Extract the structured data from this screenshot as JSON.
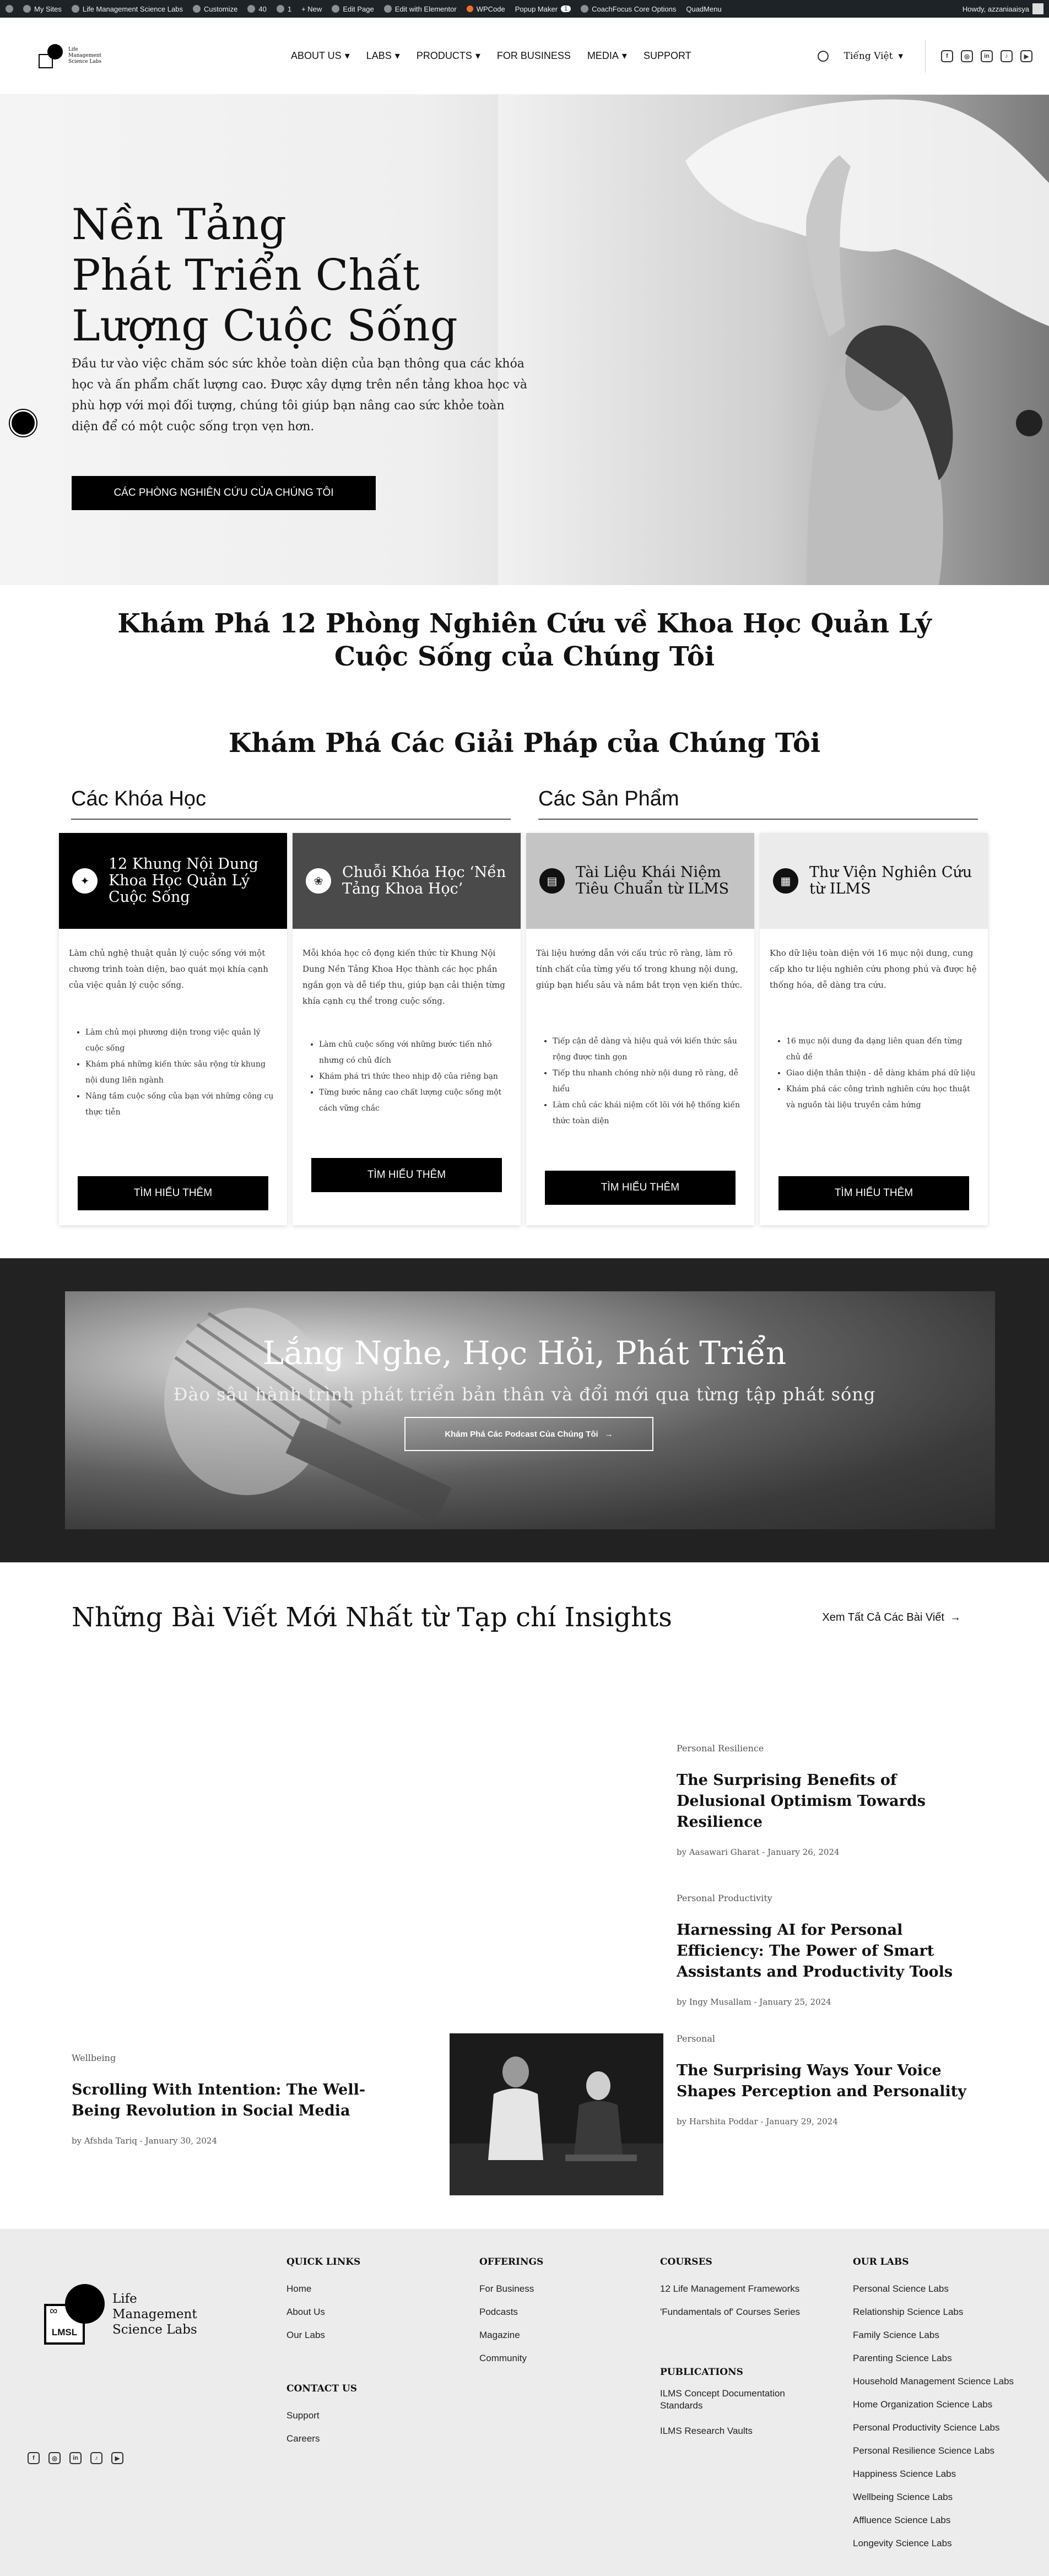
{
  "adminbar": {
    "items": [
      "My Sites",
      "Life Management Science Labs",
      "Customize",
      "40",
      "1",
      "+ New",
      "Edit Page",
      "Edit with Elementor",
      "WPCode",
      "Popup Maker",
      "CoachFocus Core Options",
      "QuadMenu"
    ],
    "popup_badge": "1",
    "howdy": "Howdy, azzaniaaisya"
  },
  "header": {
    "logo_text": "Life Management Science Labs",
    "nav": [
      "ABOUT US",
      "LABS",
      "PRODUCTS",
      "FOR BUSINESS",
      "MEDIA",
      "SUPPORT"
    ],
    "language": "Tiếng Việt"
  },
  "hero": {
    "title_lines": [
      "Nền Tảng",
      "Phát Triển Chất",
      "Lượng Cuộc Sống"
    ],
    "text": "Đầu tư vào việc chăm sóc sức khỏe toàn diện của bạn thông qua các khóa học và ấn phẩm chất lượng cao. Được xây dựng trên nền tảng khoa học và phù hợp với mọi đối tượng, chúng tôi giúp bạn nâng cao sức khỏe toàn diện để có một cuộc sống trọn vẹn hơn.",
    "button": "CÁC PHÒNG NGHIÊN CỨU CỦA CHÚNG TÔI"
  },
  "intro": {
    "title": "Khám Phá 12 Phòng Nghiên Cứu về Khoa Học Quản Lý Cuộc Sống của Chúng Tôi"
  },
  "solutions": {
    "title": "Khám Phá Các Giải Pháp của Chúng Tôi",
    "heading_courses": "Các Khóa Học",
    "heading_products": "Các Sản Phẩm",
    "cards": [
      {
        "title": "12 Khung Nội Dung Khoa Học Quản Lý Cuộc Sống",
        "desc": "Làm chủ nghệ thuật quản lý cuộc sống với một chương trình toàn diện, bao quát mọi khía cạnh của việc quản lý cuộc sống.",
        "items": [
          "Làm chủ mọi phương diện trong việc quản lý cuộc sống",
          "Khám phá những kiến thức sâu rộng từ khung nội dung liên ngành",
          "Nâng tầm cuộc sống của bạn với những công cụ thực tiễn"
        ],
        "button": "TÌM HIỂU THÊM"
      },
      {
        "title": "Chuỗi Khóa Học ‘Nền Tảng Khoa Học’",
        "desc": "Mỗi khóa học cô đọng kiến thức từ Khung Nội Dung Nền Tảng Khoa Học thành các học phần ngắn gọn và dễ tiếp thu, giúp bạn cải thiện từng khía cạnh cụ thể trong cuộc sống.",
        "items": [
          "Làm chủ cuộc sống với những bước tiến nhỏ nhưng có chủ đích",
          "Khám phá tri thức theo nhịp độ của riêng bạn",
          "Từng bước nâng cao chất lượng cuộc sống một cách vững chắc"
        ],
        "button": "TÌM HIỂU THÊM"
      },
      {
        "title": "Tài Liệu Khái Niệm Tiêu Chuẩn từ ILMS",
        "desc": "Tài liệu hướng dẫn với cấu trúc rõ ràng, làm rõ tính chất của từng yếu tố trong khung nội dung, giúp bạn hiểu sâu và nắm bắt trọn vẹn kiến thức.",
        "items": [
          "Tiếp cận dễ dàng và hiệu quả với kiến thức sâu rộng được tinh gọn",
          "Tiếp thu nhanh chóng nhờ nội dung rõ ràng, dễ hiểu",
          "Làm chủ các khái niệm cốt lõi với hệ thống kiến thức toàn diện"
        ],
        "button": "TÌM HIỂU THÊM"
      },
      {
        "title": "Thư Viện Nghiên Cứu từ ILMS",
        "desc": "Kho dữ liệu toàn diện với 16 mục nội dung, cung cấp kho tư liệu nghiên cứu phong phú và được hệ thống hóa, dễ dàng tra cứu.",
        "items": [
          "16 mục nội dung đa dạng liên quan đến từng chủ đề",
          "Giao diện thân thiện - dễ dàng khám phá dữ liệu",
          "Khám phá các công trình nghiên cứu học thuật và nguồn tài liệu truyền cảm hứng"
        ],
        "button": "TÌM HIỂU THÊM"
      }
    ]
  },
  "podcast": {
    "title": "Lắng Nghe, Học Hỏi, Phát Triển",
    "subtitle": "Đào sâu hành trình phát triển bản thân và đổi mới qua từng tập phát sóng",
    "button": "Khám Phá Các Podcast Của Chúng Tôi"
  },
  "insights": {
    "title": "Những Bài Viết Mới Nhất từ Tạp chí Insights",
    "view_all": "Xem Tất Cả Các Bài Viết",
    "posts": [
      {
        "category": "Personal Resilience",
        "title": "The Surprising Benefits of Delusional Optimism Towards Resilience",
        "meta": "by Aasawari Gharat - January 26, 2024"
      },
      {
        "category": "Personal Productivity",
        "title": "Harnessing AI for Personal Efficiency: The Power of Smart Assistants and Productivity Tools",
        "meta": "by Ingy Musallam - January 25, 2024"
      },
      {
        "category": "Wellbeing",
        "title": "Scrolling With Intention: The Well-Being Revolution in Social Media",
        "meta": "by Afshda Tariq - January 30, 2024"
      },
      {
        "category": "Personal",
        "title": "The Surprising Ways Your Voice Shapes Perception and Personality",
        "meta": "by Harshita Poddar - January 29, 2024"
      }
    ]
  },
  "footer": {
    "brand": "Life Management Science Labs",
    "logo_mark": "LMSL",
    "logo_symbol": "∞",
    "quick_links": {
      "title": "QUICK LINKS",
      "items": [
        "Home",
        "About Us",
        "Our Labs"
      ]
    },
    "contact_us": {
      "title": "CONTACT US",
      "items": [
        "Support",
        "Careers"
      ]
    },
    "offerings": {
      "title": "OFFERINGS",
      "items": [
        "For Business",
        "Podcasts",
        "Magazine",
        "Community"
      ]
    },
    "courses": {
      "title": "COURSES",
      "items": [
        "12 Life Management Frameworks",
        "'Fundamentals of' Courses Series"
      ]
    },
    "publications": {
      "title": "PUBLICATIONS",
      "items": [
        "ILMS Concept Documentation Standards",
        "ILMS Research Vaults"
      ]
    },
    "our_labs": {
      "title": "OUR LABS",
      "items": [
        "Personal Science Labs",
        "Relationship Science Labs",
        "Family Science Labs",
        "Parenting Science Labs",
        "Household Management Science Labs",
        "Home Organization Science Labs",
        "Personal Productivity Science Labs",
        "Personal Resilience Science Labs",
        "Happiness Science Labs",
        "Wellbeing Science Labs",
        "Affluence Science Labs",
        "Longevity Science Labs"
      ]
    }
  },
  "colors": {
    "black": "#000000",
    "admin_bar": "#1d2327",
    "podcast_band": "#222222",
    "footer_bg": "#ececec"
  }
}
